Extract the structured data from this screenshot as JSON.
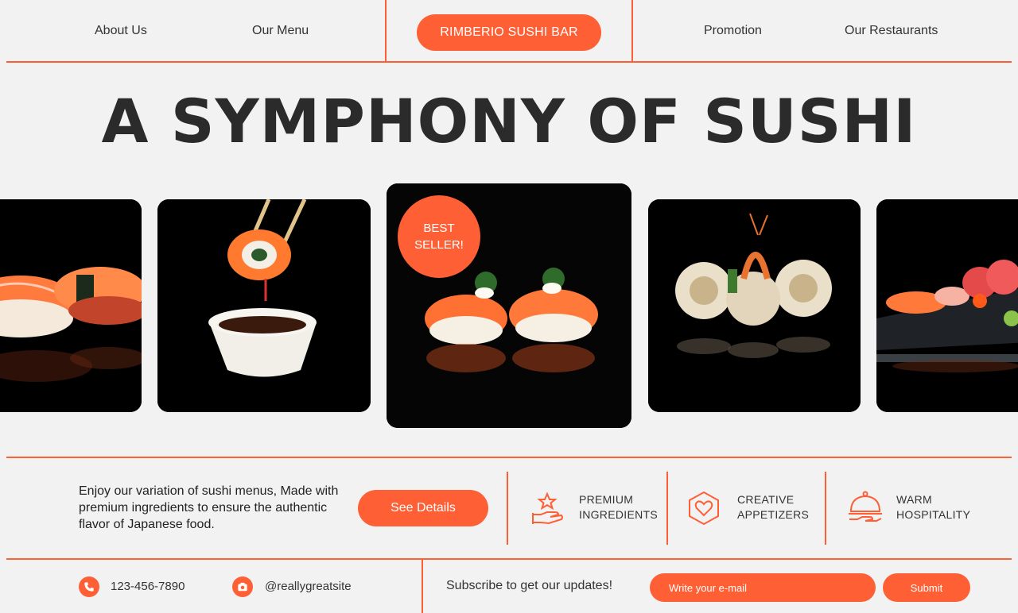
{
  "nav": {
    "about": "About Us",
    "menu": "Our Menu",
    "brand": "RIMBERIO SUSHI BAR",
    "promotion": "Promotion",
    "restaurants": "Our Restaurants"
  },
  "hero": {
    "title": "A SYMPHONY OF SUSHI"
  },
  "gallery": {
    "badge_line1": "BEST",
    "badge_line2": "SELLER!",
    "images": [
      "salmon-nigiri-photo",
      "chopsticks-roll-dip-photo",
      "salmon-nigiri-featured-photo",
      "shrimp-tempura-roll-photo",
      "sashimi-platter-photo"
    ]
  },
  "info": {
    "description": "Enjoy our variation of sushi menus, Made with premium ingredients to ensure the authentic flavor of Japanese food.",
    "details_button": "See Details",
    "features": [
      {
        "line1": "PREMIUM",
        "line2": "INGREDIENTS",
        "icon": "star-hand-icon"
      },
      {
        "line1": "CREATIVE",
        "line2": "APPETIZERS",
        "icon": "heart-hexagon-icon"
      },
      {
        "line1": "WARM",
        "line2": "HOSPITALITY",
        "icon": "cloche-icon"
      }
    ]
  },
  "footer": {
    "phone": "123-456-7890",
    "social": "@reallygreatsite",
    "subscribe_text": "Subscribe to get our updates!",
    "email_placeholder": "Write your e-mail",
    "submit_label": "Submit"
  },
  "colors": {
    "accent": "#ff5f35",
    "background": "#f3f2f2",
    "text": "#2b2b2b"
  }
}
